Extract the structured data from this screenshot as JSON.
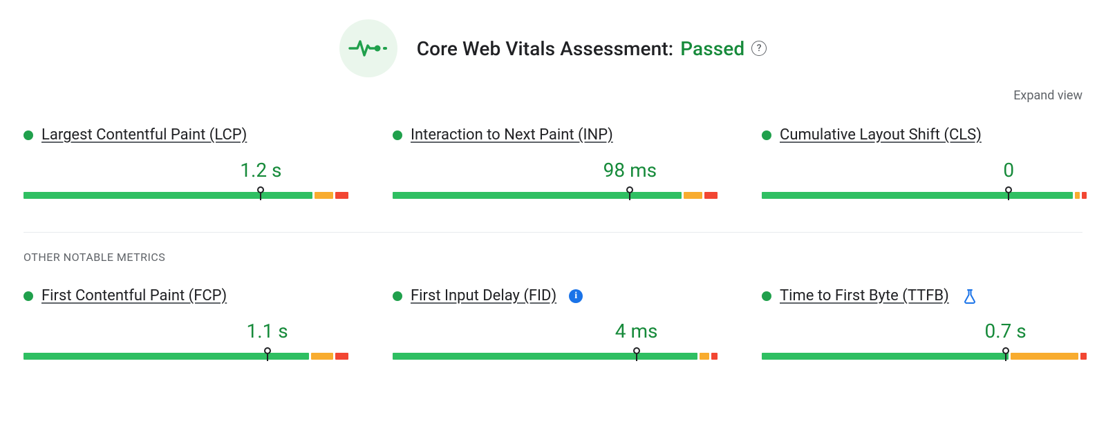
{
  "header": {
    "title_prefix": "Core Web Vitals Assessment:",
    "status": "Passed"
  },
  "expand_label": "Expand view",
  "section_other_label": "OTHER NOTABLE METRICS",
  "colors": {
    "good": "#20a04c",
    "warn": "#f8ac2f",
    "poor": "#f24632"
  },
  "metrics": {
    "lcp": {
      "name": "Largest Contentful Paint (LCP)",
      "value": "1.2 s",
      "status": "good",
      "marker_pct": 74,
      "bars": {
        "g": 90,
        "o": 6,
        "r": 4
      }
    },
    "inp": {
      "name": "Interaction to Next Paint (INP)",
      "value": "98 ms",
      "status": "good",
      "marker_pct": 74,
      "bars": {
        "g": 90,
        "o": 6,
        "r": 4
      }
    },
    "cls": {
      "name": "Cumulative Layout Shift (CLS)",
      "value": "0",
      "status": "good",
      "marker_pct": 77,
      "bars": {
        "g": 97,
        "o": 1.5,
        "r": 1.5
      }
    },
    "fcp": {
      "name": "First Contentful Paint (FCP)",
      "value": "1.1 s",
      "status": "good",
      "marker_pct": 76,
      "bars": {
        "g": 89,
        "o": 7,
        "r": 4
      }
    },
    "fid": {
      "name": "First Input Delay (FID)",
      "value": "4 ms",
      "status": "good",
      "info": true,
      "marker_pct": 76,
      "bars": {
        "g": 95,
        "o": 3,
        "r": 2
      }
    },
    "ttfb": {
      "name": "Time to First Byte (TTFB)",
      "value": "0.7 s",
      "status": "good",
      "flask": true,
      "marker_pct": 76,
      "bars": {
        "g": 77,
        "o": 21,
        "r": 2
      }
    }
  }
}
